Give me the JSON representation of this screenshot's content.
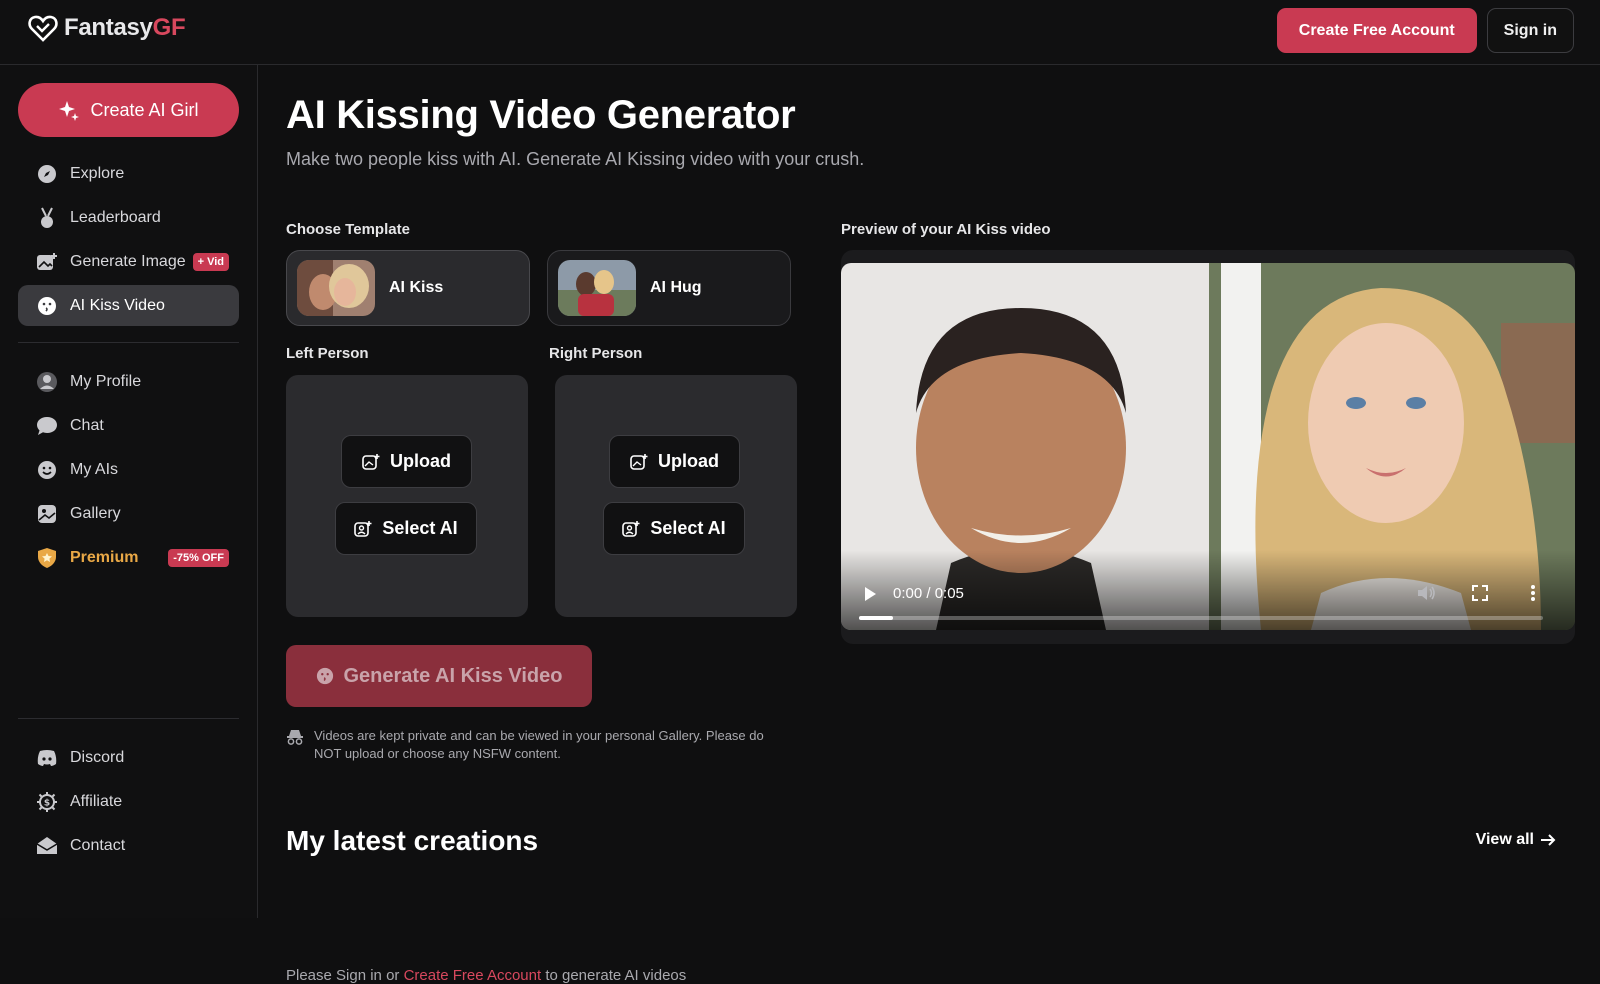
{
  "header": {
    "logo_text_main": "Fantasy",
    "logo_text_accent": "GF",
    "create_account": "Create Free Account",
    "sign_in": "Sign in"
  },
  "sidebar": {
    "create_button": "Create AI Girl",
    "items": [
      {
        "label": "Explore",
        "icon": "compass-icon"
      },
      {
        "label": "Leaderboard",
        "icon": "medal-icon"
      },
      {
        "label": "Generate Image",
        "icon": "image-plus-icon",
        "badge": "+ Vid"
      },
      {
        "label": "AI Kiss Video",
        "icon": "kiss-face-icon"
      },
      {
        "label": "My Profile",
        "icon": "user-icon"
      },
      {
        "label": "Chat",
        "icon": "chat-icon"
      },
      {
        "label": "My AIs",
        "icon": "smile-icon"
      },
      {
        "label": "Gallery",
        "icon": "gallery-icon"
      },
      {
        "label": "Premium",
        "icon": "shield-icon",
        "badge": "-75% OFF"
      },
      {
        "label": "Discord",
        "icon": "discord-icon"
      },
      {
        "label": "Affiliate",
        "icon": "dollar-icon"
      },
      {
        "label": "Contact",
        "icon": "mail-icon"
      }
    ]
  },
  "main": {
    "title": "AI Kissing Video Generator",
    "subtitle": "Make two people kiss with AI. Generate AI Kissing video with your crush.",
    "choose_template": "Choose Template",
    "templates": [
      {
        "label": "AI Kiss"
      },
      {
        "label": "AI Hug"
      }
    ],
    "left_person": "Left Person",
    "right_person": "Right Person",
    "upload": "Upload",
    "select_ai": "Select AI",
    "generate": "Generate AI Kiss Video",
    "note": "Videos are kept private and can be viewed in your personal Gallery. Please do NOT upload or choose any NSFW content.",
    "preview_label": "Preview of your AI Kiss video",
    "video_time": "0:00 / 0:05",
    "video_progress": 0.05,
    "latest": "My latest creations",
    "view_all": "View all",
    "cut_text_start": "Please Sign in or ",
    "cut_text_link": "Create Free Account",
    "cut_text_end": " to generate AI videos"
  },
  "colors": {
    "accent": "#c93a52",
    "premium": "#e9a846"
  }
}
